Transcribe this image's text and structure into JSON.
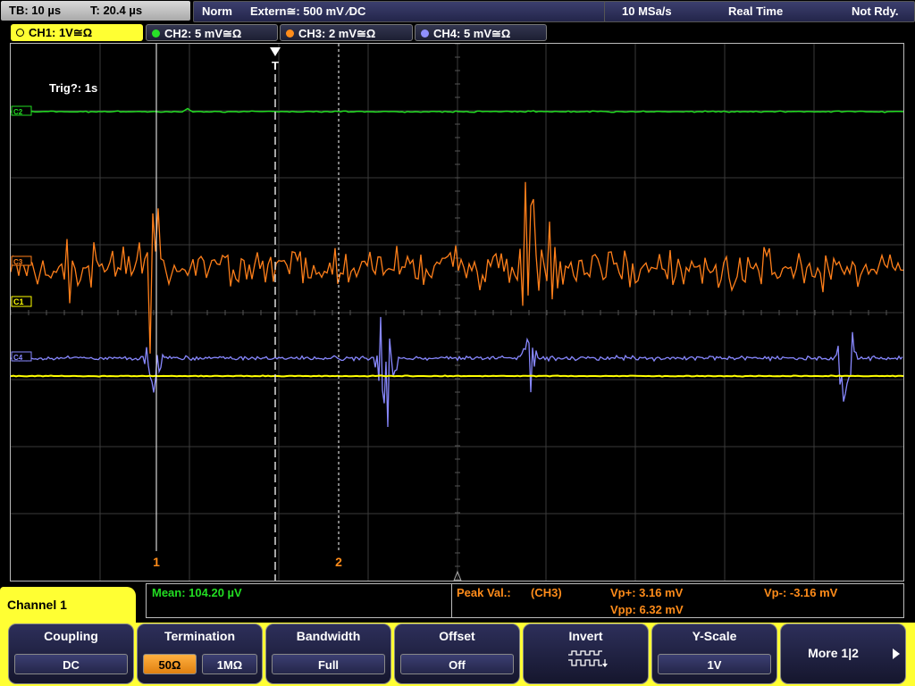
{
  "status_bar": {
    "timebase": "TB: 10 µs",
    "trigger_time": "T: 20.4 µs",
    "trigger_mode": "Norm",
    "trigger_source": "Extern≅: 500 mV ⁄DC",
    "sample_rate": "10 MSa/s",
    "acq_mode": "Real Time",
    "status": "Not Rdy."
  },
  "channel_tabs": [
    {
      "label": "CH1: 1V≅Ω",
      "color": "#ffff33",
      "active": true
    },
    {
      "label": "CH2: 5 mV≅Ω",
      "color": "#28e028",
      "active": false
    },
    {
      "label": "CH3: 2 mV≅Ω",
      "color": "#ff8c1a",
      "active": false
    },
    {
      "label": "CH4: 5 mV≅Ω",
      "color": "#9090ff",
      "active": false
    }
  ],
  "screen": {
    "trigger_info": "Trig?: 1s",
    "trigger_marker": "T",
    "cursor1_label": "1",
    "cursor2_label": "2",
    "ch1_marker": "C1",
    "ch2_marker": "C2",
    "ch3_marker": "C3",
    "ch4_marker": "C4",
    "colors": {
      "ch1": "#ffff00",
      "ch2": "#22dd22",
      "ch3": "#ff7f1a",
      "ch4": "#8888ff",
      "grid": "#3a3a3a"
    }
  },
  "measurements": {
    "mean": "Mean: 104.20 µV",
    "peak_label": "Peak Val.:",
    "peak_source": "(CH3)",
    "vp_plus": "Vp+: 3.16 mV",
    "vp_minus": "Vp-: -3.16 mV",
    "vpp": "Vpp: 6.32 mV"
  },
  "menu": {
    "title": "Channel 1",
    "keys": [
      {
        "title": "Coupling",
        "value": "DC"
      },
      {
        "title": "Termination",
        "options": [
          "50Ω",
          "1MΩ"
        ],
        "selected": 0
      },
      {
        "title": "Bandwidth",
        "value": "Full"
      },
      {
        "title": "Offset",
        "value": "Off"
      },
      {
        "title": "Invert",
        "icon": "invert-waveform-icon"
      },
      {
        "title": "Y-Scale",
        "value": "1V"
      },
      {
        "title": "More 1|2",
        "icon": "arrow-right-icon"
      }
    ]
  }
}
